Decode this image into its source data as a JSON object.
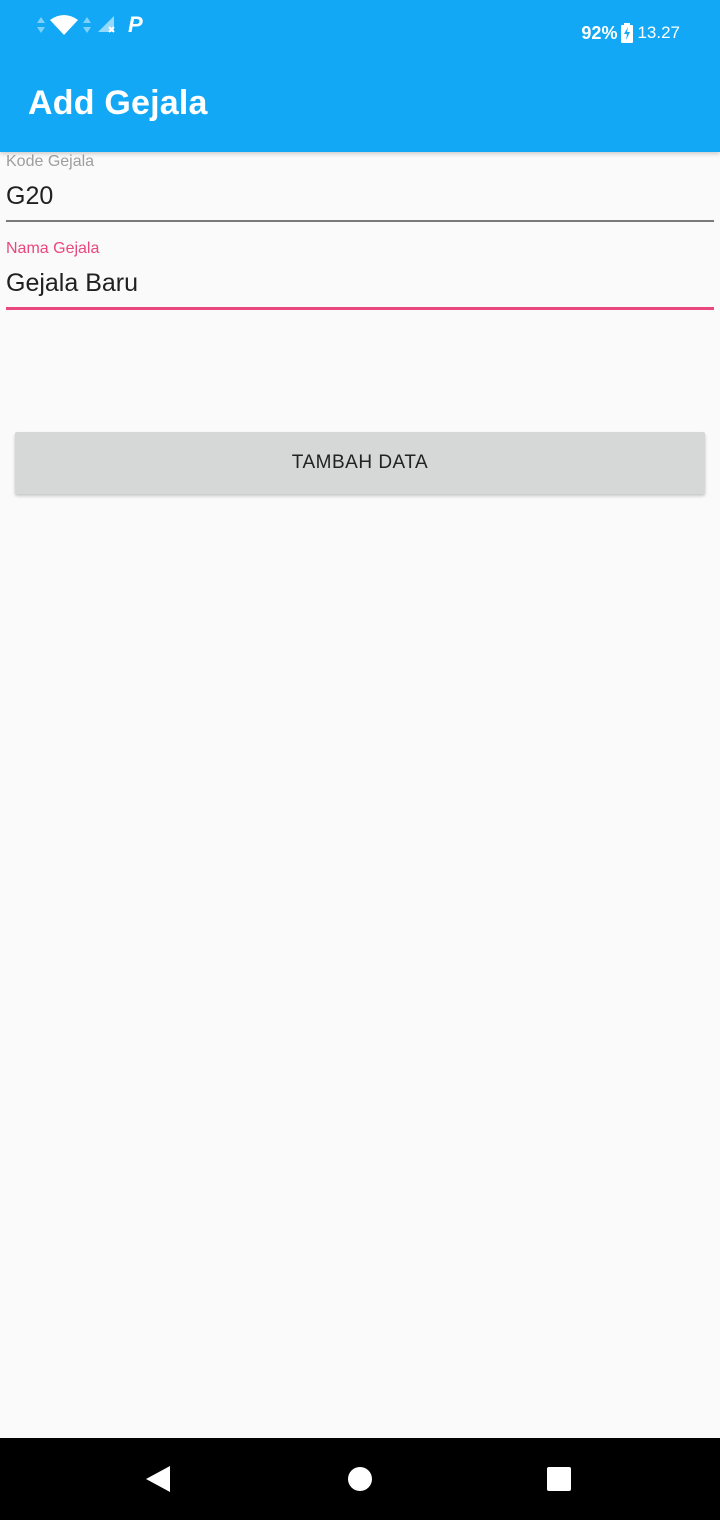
{
  "status_bar": {
    "battery": "92%",
    "time": "13.27",
    "icons": [
      "data-arrows-icon",
      "wifi-icon",
      "data-arrows-icon",
      "signal-no-sim-icon",
      "parking-app-icon",
      "battery-charging-icon"
    ],
    "parking_glyph": "P"
  },
  "app_bar": {
    "title": "Add Gejala",
    "color": "#12a8f6"
  },
  "form": {
    "kode": {
      "label": "Kode Gejala",
      "value": "G20"
    },
    "nama": {
      "label": "Nama Gejala",
      "value": "Gejala Baru",
      "focused": true,
      "accent_color": "#e8487d"
    },
    "submit_label": "TAMBAH DATA"
  },
  "nav_bar": {
    "buttons": [
      "back-icon",
      "home-icon",
      "recents-icon"
    ]
  }
}
